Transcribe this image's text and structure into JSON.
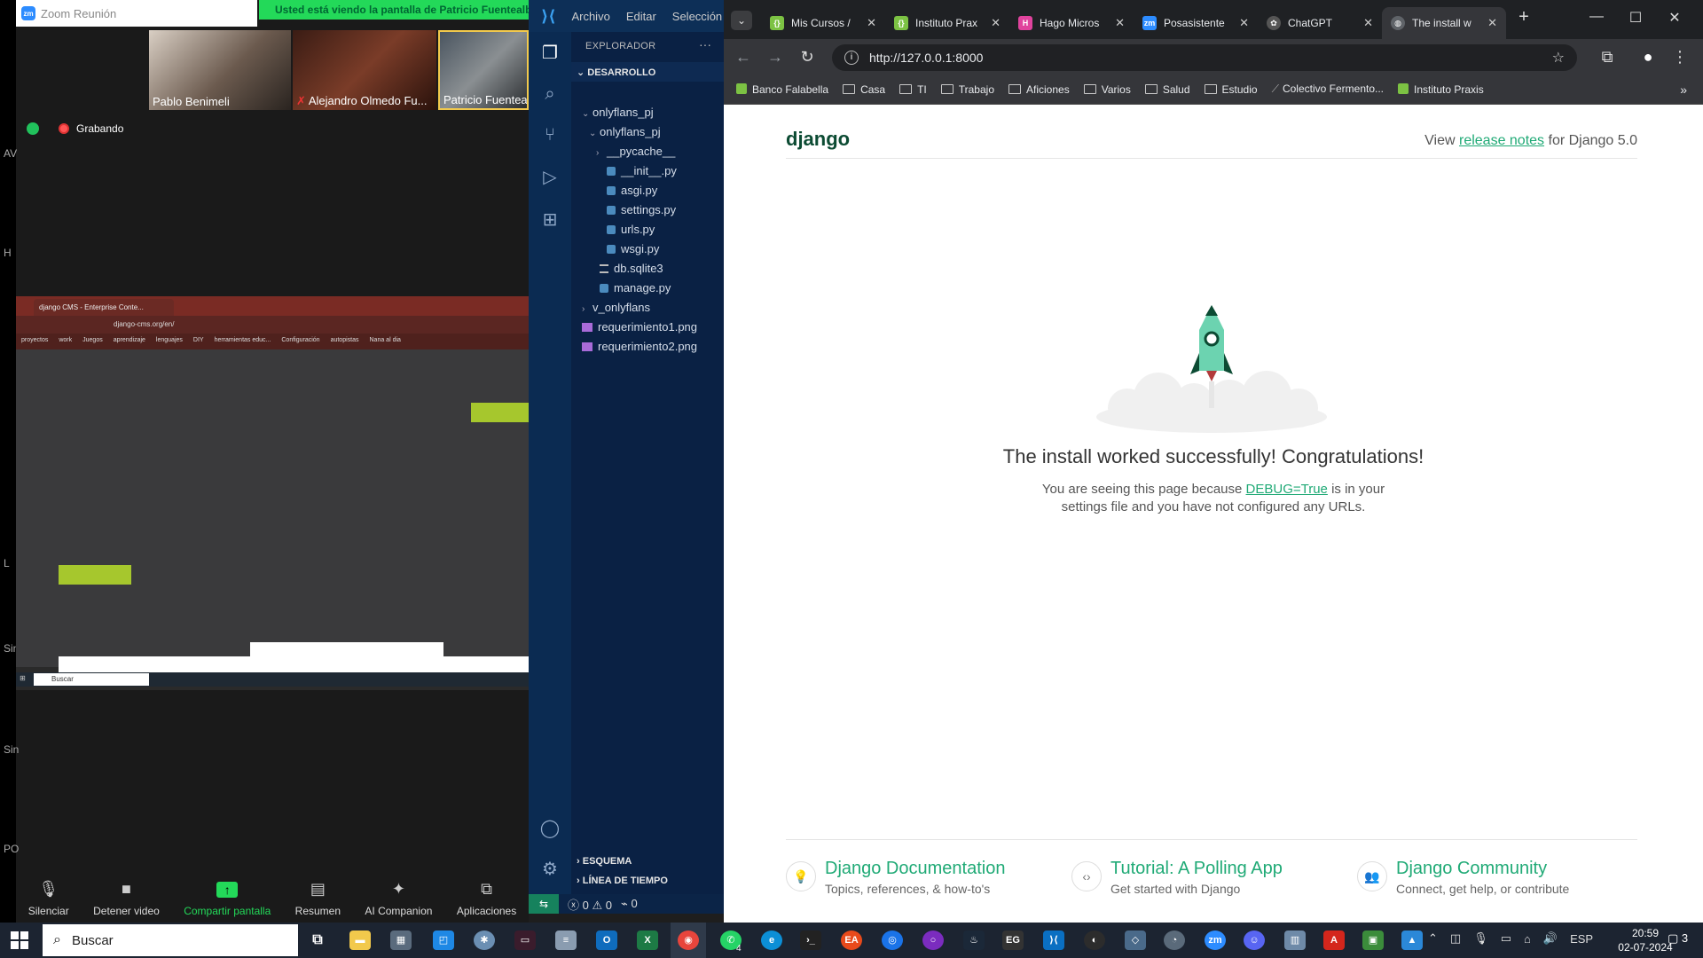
{
  "zoom": {
    "window_title": "Zoom Reunión",
    "share_banner": "Usted está viendo la pantalla de Patricio Fuentealba",
    "participants": [
      "Pablo Benimeli",
      "Alejandro Olmedo Fu...",
      "Patricio Fuenteall"
    ],
    "recording_label": "Grabando",
    "left_edge_labels": [
      "AV",
      "H",
      "L",
      "Sin",
      "Sin",
      "PO"
    ],
    "controls": {
      "mute": "Silenciar",
      "video": "Detener video",
      "share": "Compartir pantalla",
      "summary": "Resumen",
      "companion": "AI Companion",
      "apps": "Aplicaciones"
    },
    "shared_screen": {
      "tab_title": "django CMS - Enterprise Conte...",
      "url": "django-cms.org/en/",
      "bookmarks": [
        "proyectos",
        "work",
        "Juegos",
        "aprendizaje",
        "lenguajes",
        "DIY",
        "herramientas educ...",
        "Configuración",
        "autopistas",
        "Nana al dia"
      ],
      "taskbar_search": "Buscar"
    }
  },
  "vscode": {
    "menu": [
      "Archivo",
      "Editar",
      "Selección"
    ],
    "explorer_title": "EXPLORADOR",
    "workspace": "DESARROLLO",
    "tree": [
      {
        "label": "onlyflans_pj",
        "depth": 1,
        "kind": "folder-open"
      },
      {
        "label": "onlyflans_pj",
        "depth": 2,
        "kind": "folder-open"
      },
      {
        "label": "__pycache__",
        "depth": 3,
        "kind": "folder"
      },
      {
        "label": "__init__.py",
        "depth": 3,
        "kind": "py"
      },
      {
        "label": "asgi.py",
        "depth": 3,
        "kind": "py"
      },
      {
        "label": "settings.py",
        "depth": 3,
        "kind": "py"
      },
      {
        "label": "urls.py",
        "depth": 3,
        "kind": "py"
      },
      {
        "label": "wsgi.py",
        "depth": 3,
        "kind": "py"
      },
      {
        "label": "db.sqlite3",
        "depth": 2,
        "kind": "db"
      },
      {
        "label": "manage.py",
        "depth": 2,
        "kind": "py"
      },
      {
        "label": "v_onlyflans",
        "depth": 1,
        "kind": "folder"
      },
      {
        "label": "requerimiento1.png",
        "depth": 1,
        "kind": "png"
      },
      {
        "label": "requerimiento2.png",
        "depth": 1,
        "kind": "png"
      }
    ],
    "outline": "ESQUEMA",
    "timeline": "LÍNEA DE TIEMPO",
    "status": {
      "errors": "0",
      "warnings": "0",
      "ports": "0"
    }
  },
  "chrome": {
    "tabs": [
      {
        "title": "Mis Cursos /",
        "icon": "praxis-icon"
      },
      {
        "title": "Instituto Prax",
        "icon": "praxis-icon"
      },
      {
        "title": "Hago Micros",
        "icon": "hago-icon"
      },
      {
        "title": "Posasistente",
        "icon": "zoom-icon"
      },
      {
        "title": "ChatGPT",
        "icon": "chatgpt-icon"
      },
      {
        "title": "The install w",
        "icon": "globe-icon"
      }
    ],
    "url": "http://127.0.0.1:8000",
    "bookmarks": [
      "Banco Falabella",
      "Casa",
      "TI",
      "Trabajo",
      "Aficiones",
      "Varios",
      "Salud",
      "Estudio",
      "Colectivo Fermento...",
      "Instituto Praxis"
    ],
    "page": {
      "logo": "django",
      "release_prefix": "View ",
      "release_link": "release notes",
      "release_suffix": " for Django 5.0",
      "headline": "The install worked successfully! Congratulations!",
      "msg_prefix": "You are seeing this page because ",
      "msg_link": "DEBUG=True",
      "msg_suffix": " is in your",
      "msg_line2": "settings file and you have not configured any URLs.",
      "cards": [
        {
          "title": "Django Documentation",
          "subtitle": "Topics, references, & how-to's"
        },
        {
          "title": "Tutorial: A Polling App",
          "subtitle": "Get started with Django"
        },
        {
          "title": "Django Community",
          "subtitle": "Connect, get help, or contribute"
        }
      ]
    }
  },
  "taskbar": {
    "search": "Buscar",
    "language": "ESP",
    "time": "20:59",
    "date": "02-07-2024",
    "whatsapp_badge": "4",
    "notifications": "3"
  },
  "colors": {
    "django_green": "#20aa76",
    "django_dark": "#0c4b33",
    "zoom_green": "#23d959",
    "vscode_blue": "#0a2144"
  }
}
